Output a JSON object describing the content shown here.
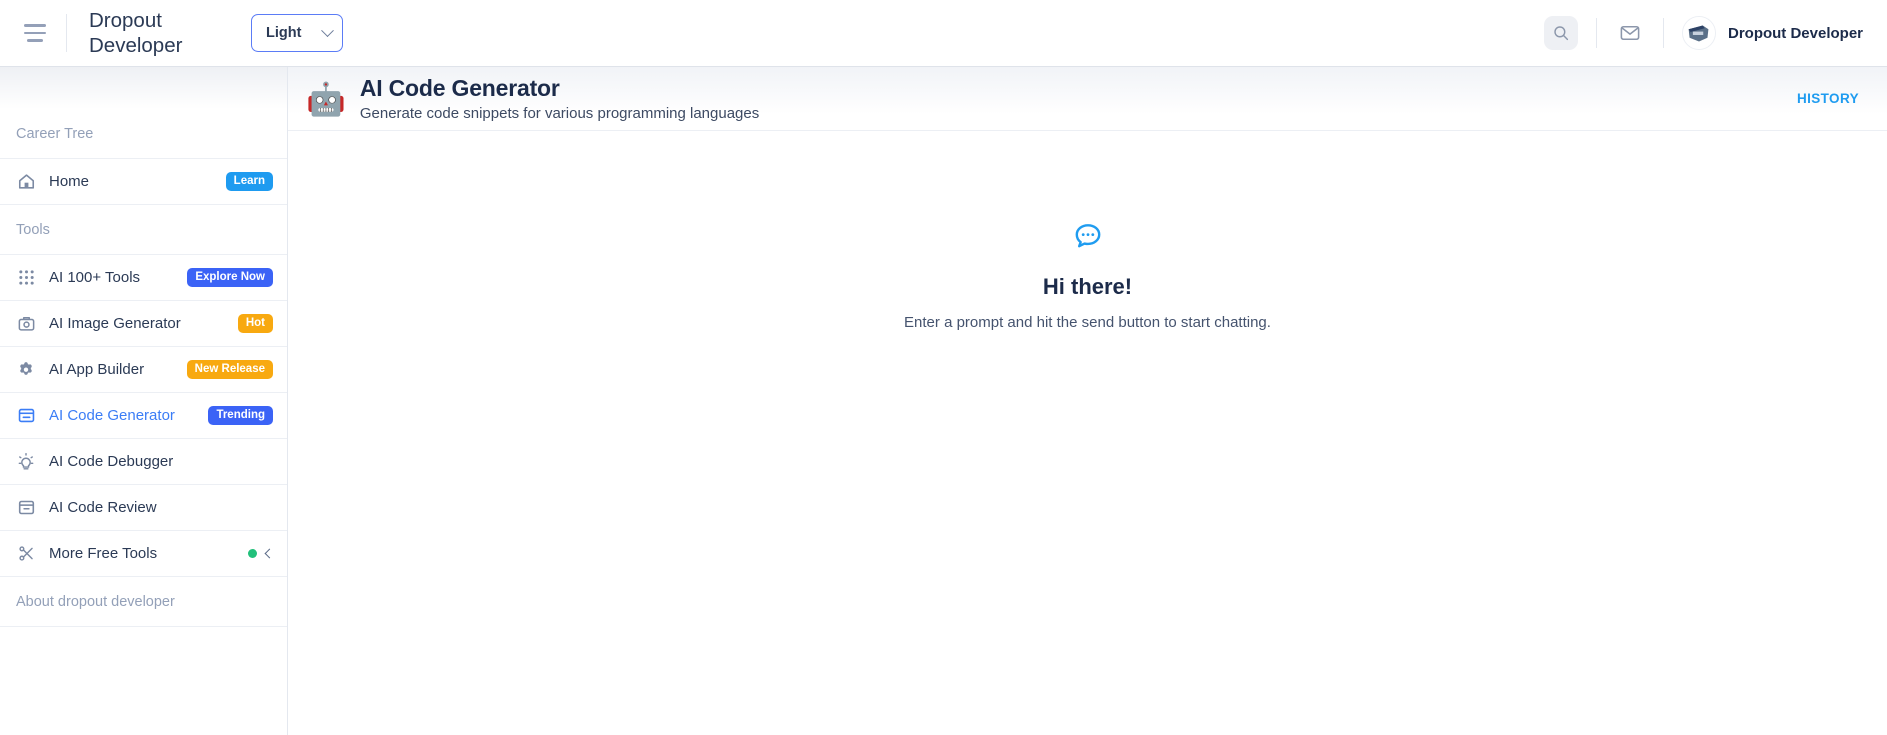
{
  "topbar": {
    "menu_icon": "hamburger-icon",
    "brand": "Dropout Developer",
    "theme": {
      "value": "Light",
      "chevron_icon": "chevron-down-icon"
    },
    "search_icon": "search-icon",
    "mail_icon": "mail-icon",
    "user": {
      "name": "Dropout Developer",
      "avatar_icon": "avatar"
    }
  },
  "sidebar": {
    "sections": {
      "career": "Career Tree",
      "tools": "Tools",
      "about": "About dropout developer"
    },
    "career_items": [
      {
        "label": "Home",
        "icon": "home-icon",
        "badge": "Learn",
        "badge_color": "#1e9bf0",
        "active": false
      }
    ],
    "tool_items": [
      {
        "label": "AI 100+ Tools",
        "icon": "grid-dots-icon",
        "badge": "Explore Now",
        "badge_color": "#3b63f6",
        "active": false
      },
      {
        "label": "AI Image Generator",
        "icon": "camera-icon",
        "badge": "Hot",
        "badge_color": "#f8a910",
        "active": false
      },
      {
        "label": "AI App Builder",
        "icon": "gear-icon",
        "badge": "New Release",
        "badge_color": "#f8a910",
        "active": false
      },
      {
        "label": "AI Code Generator",
        "icon": "code-window-icon",
        "badge": "Trending",
        "badge_color": "#3b63f6",
        "active": true
      },
      {
        "label": "AI Code Debugger",
        "icon": "lightbulb-icon",
        "badge": "",
        "badge_color": "",
        "active": false
      },
      {
        "label": "AI Code Review",
        "icon": "archive-icon",
        "badge": "",
        "badge_color": "",
        "active": false
      },
      {
        "label": "More Free Tools",
        "icon": "scissors-icon",
        "badge": "",
        "badge_color": "",
        "active": false,
        "status_dot": "#22c07b",
        "chevron_icon": "chevron-left-icon"
      }
    ]
  },
  "main": {
    "tool_emoji": "🤖",
    "title": "AI Code Generator",
    "subtitle": "Generate code snippets for various programming languages",
    "history_label": "HISTORY",
    "empty_state": {
      "icon": "chat-bubble-dots-icon",
      "title": "Hi there!",
      "subtitle": "Enter a prompt and hit the send button to start chatting."
    }
  }
}
